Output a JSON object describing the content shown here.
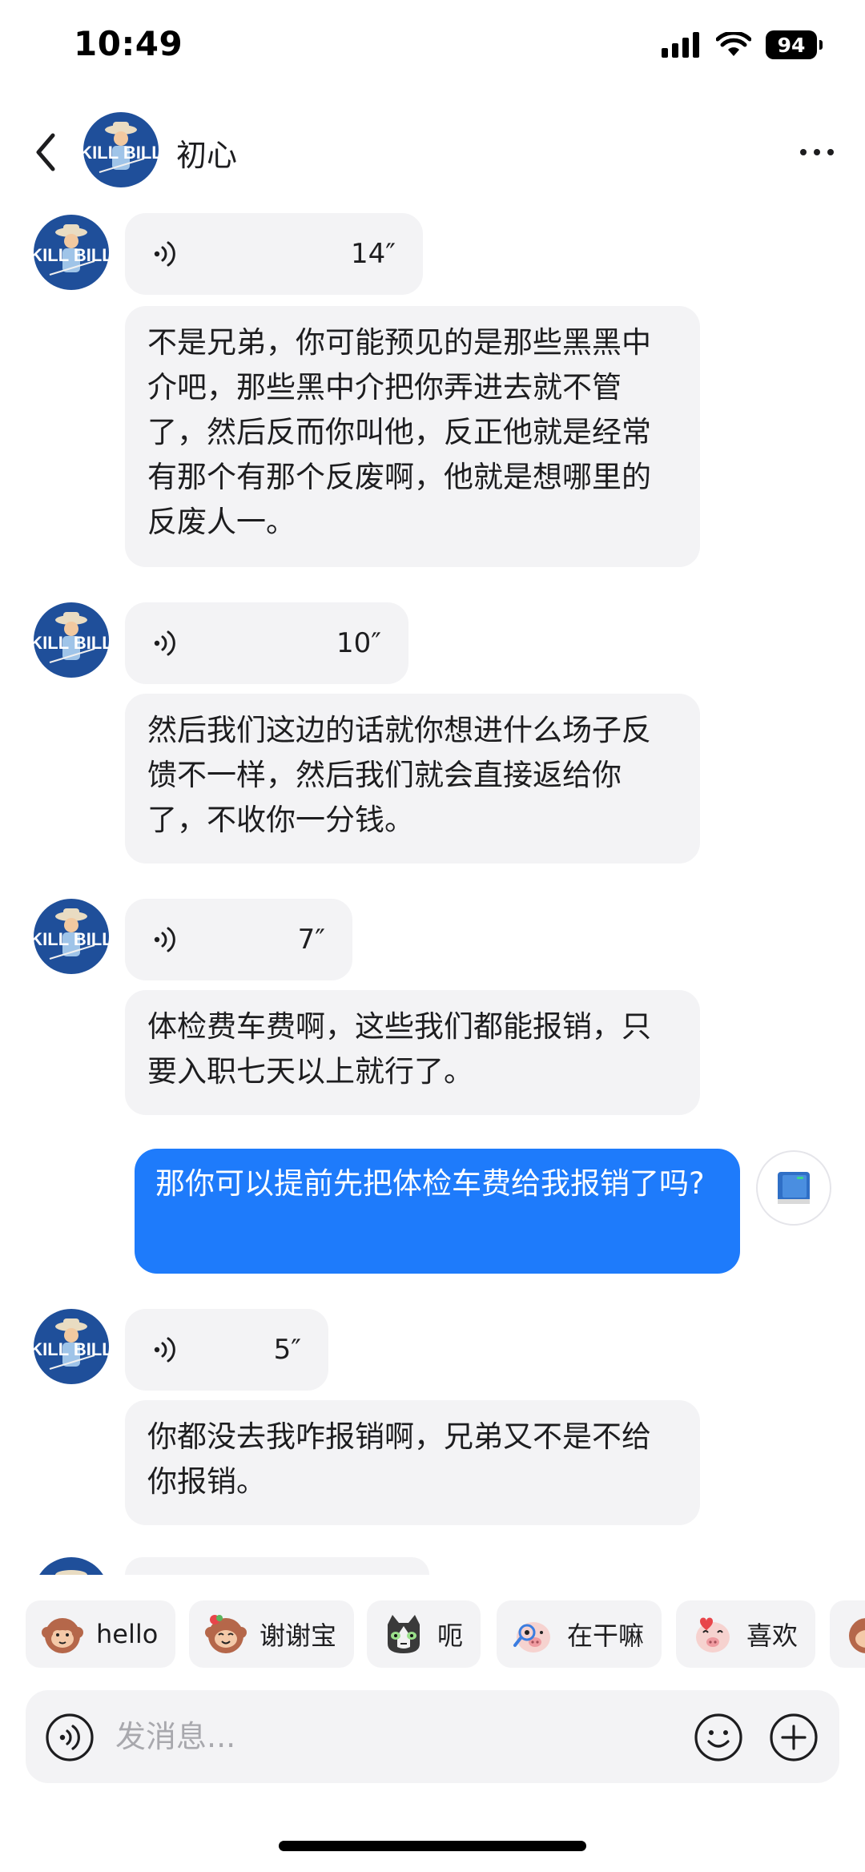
{
  "status_bar": {
    "time": "10:49",
    "battery": "94"
  },
  "header": {
    "title": "初心",
    "avatar_text": "KILL BILL"
  },
  "messages": [
    {
      "type": "voice",
      "duration": "14″"
    },
    {
      "type": "text",
      "text": "不是兄弟，你可能预见的是那些黑黑中介吧，那些黑中介把你弄进去就不管了，然后反而你叫他，反正他就是经常有那个有那个反废啊，他就是想哪里的反废人一。"
    },
    {
      "type": "voice",
      "duration": "10″"
    },
    {
      "type": "text",
      "text": "然后我们这边的话就你想进什么场子反馈不一样，然后我们就会直接返给你了，不收你一分钱。"
    },
    {
      "type": "voice",
      "duration": "7″"
    },
    {
      "type": "text",
      "text": "体检费车费啊，这些我们都能报销，只要入职七天以上就行了。"
    },
    {
      "type": "sent",
      "text": "那你可以提前先把体检车费给我报销了吗?"
    },
    {
      "type": "voice",
      "duration": "5″"
    },
    {
      "type": "text",
      "text": "你都没去我咋报销啊，兄弟又不是不给你报销。"
    }
  ],
  "quick_replies": [
    {
      "label": "hello",
      "emoji": "monkey-icon"
    },
    {
      "label": "谢谢宝",
      "emoji": "monkey-flower-icon"
    },
    {
      "label": "呃",
      "emoji": "cat-icon"
    },
    {
      "label": "在干嘛",
      "emoji": "pig-magnifier-icon"
    },
    {
      "label": "喜欢",
      "emoji": "pig-heart-icon"
    }
  ],
  "input": {
    "placeholder": "发消息..."
  },
  "colors": {
    "sent_bubble": "#1e7bfb",
    "received_bubble": "#f3f3f5",
    "avatar_bg": "#1f4f9a"
  }
}
